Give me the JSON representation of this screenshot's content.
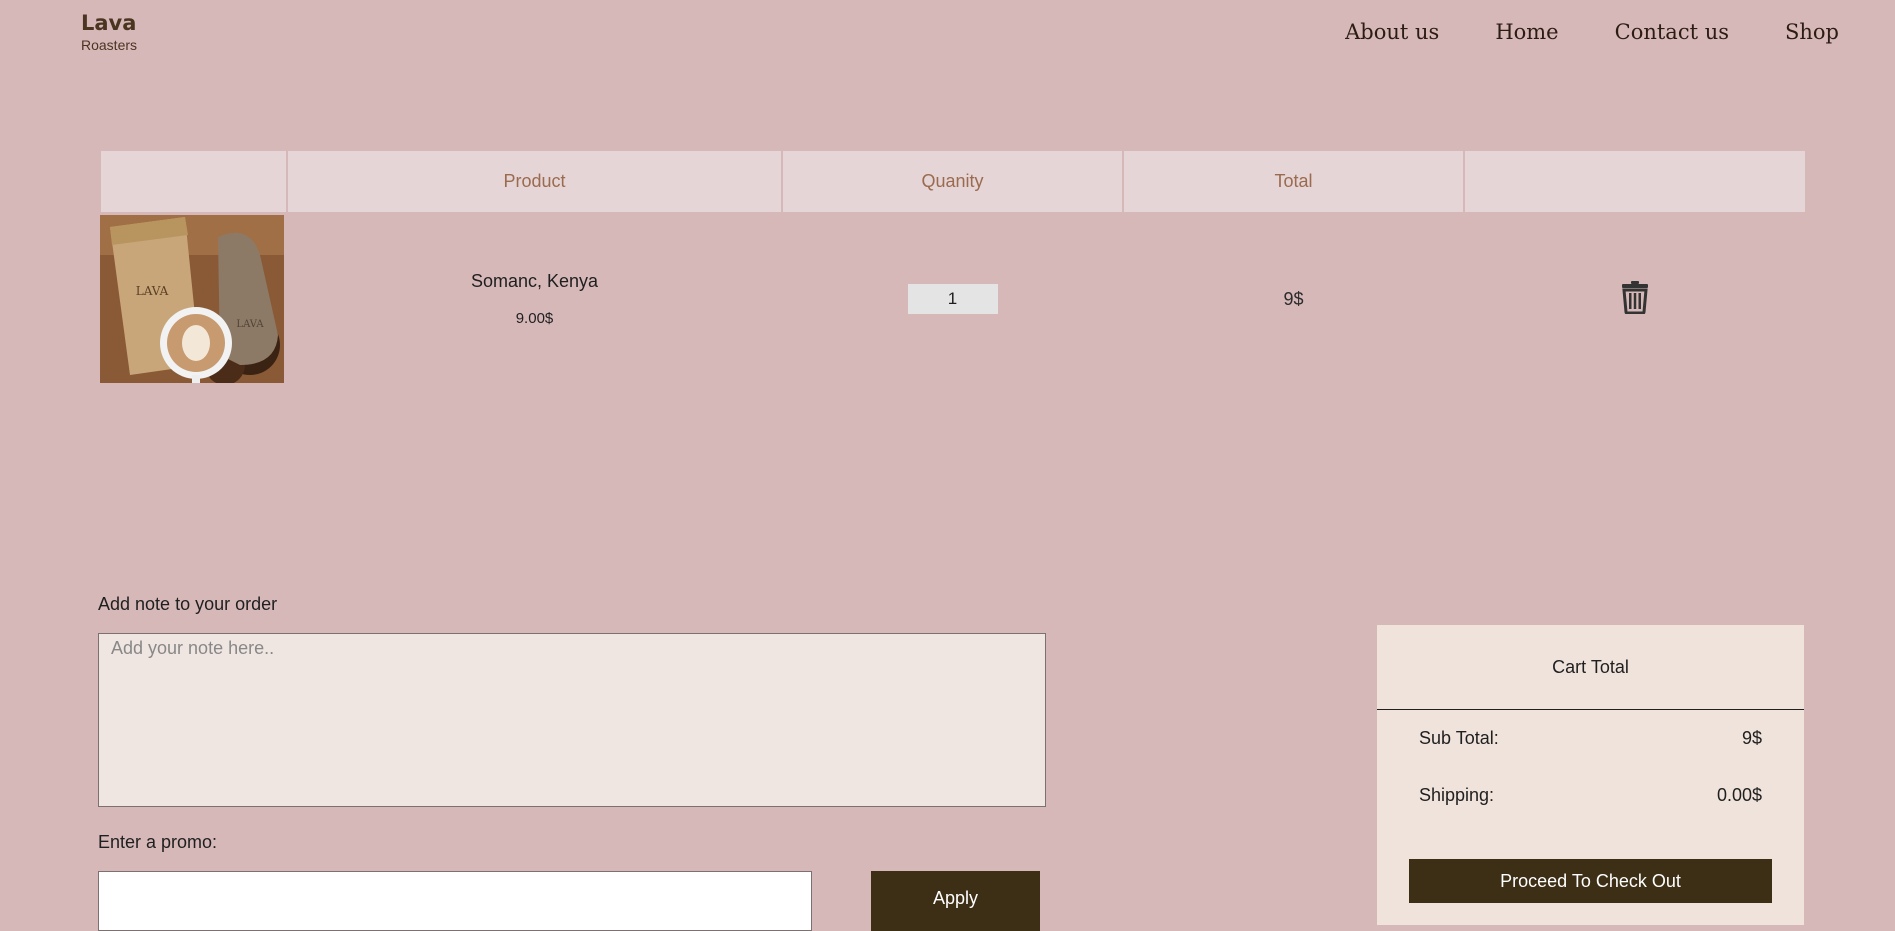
{
  "brand": {
    "name": "Lava",
    "sub": "Roasters"
  },
  "nav": [
    {
      "label": "About us"
    },
    {
      "label": "Home"
    },
    {
      "label": "Contact us"
    },
    {
      "label": "Shop"
    }
  ],
  "table": {
    "headers": [
      "",
      "Product",
      "Quanity",
      "Total",
      ""
    ],
    "items": [
      {
        "name": "Somanc, Kenya",
        "price": "9.00$",
        "quantity": "1",
        "total": "9$"
      }
    ]
  },
  "note": {
    "label": "Add note to your order",
    "placeholder": "Add your note here.."
  },
  "promo": {
    "label": "Enter a promo:",
    "button": "Apply"
  },
  "cart_total": {
    "title": "Cart Total",
    "subtotal_label": "Sub Total:",
    "subtotal_value": "9$",
    "shipping_label": "Shipping:",
    "shipping_value": "0.00$",
    "checkout": "Proceed To Check Out"
  },
  "colors": {
    "background": "#d7b8b9",
    "header_bg": "#e6d5d6",
    "accent_dark": "#3d2e16",
    "panel": "#efe3dc"
  },
  "icons": {
    "delete": "trash-icon"
  }
}
